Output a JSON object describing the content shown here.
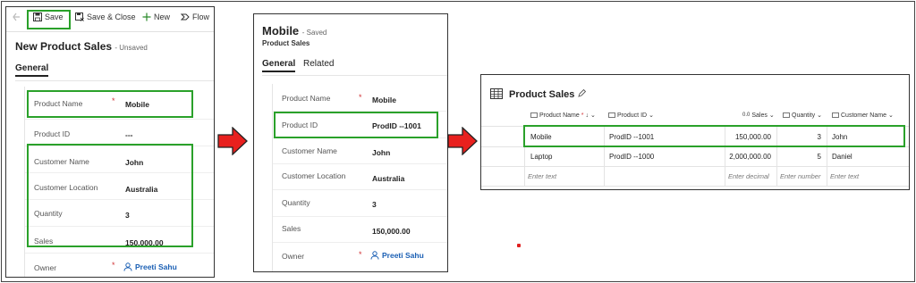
{
  "panel1": {
    "toolbar": {
      "save_label": "Save",
      "save_close_label": "Save & Close",
      "new_label": "New",
      "flow_label": "Flow"
    },
    "title": "New Product Sales",
    "status": "- Unsaved",
    "tab_general": "General",
    "fields": [
      {
        "label": "Product Name",
        "required": "*",
        "value": "Mobile"
      },
      {
        "label": "Product ID",
        "value": "---"
      },
      {
        "label": "Customer Name",
        "value": "John"
      },
      {
        "label": "Customer Location",
        "value": "Australia"
      },
      {
        "label": "Quantity",
        "value": "3"
      },
      {
        "label": "Sales",
        "value": "150,000.00"
      },
      {
        "label": "Owner",
        "required": "*",
        "value": "Preeti Sahu"
      }
    ]
  },
  "panel2": {
    "title": "Mobile",
    "status": "- Saved",
    "entity": "Product Sales",
    "tab_general": "General",
    "tab_related": "Related",
    "fields": [
      {
        "label": "Product Name",
        "required": "*",
        "value": "Mobile"
      },
      {
        "label": "Product ID",
        "value": "ProdID --1001"
      },
      {
        "label": "Customer Name",
        "value": "John"
      },
      {
        "label": "Customer Location",
        "value": "Australia"
      },
      {
        "label": "Quantity",
        "value": "3"
      },
      {
        "label": "Sales",
        "value": "150,000.00"
      },
      {
        "label": "Owner",
        "required": "*",
        "value": "Preeti Sahu"
      }
    ]
  },
  "panel3": {
    "title": "Product Sales",
    "columns": [
      "Product Name",
      "Product ID",
      "Sales",
      "Quantity",
      "Customer Name"
    ],
    "rows": [
      [
        "Mobile",
        "ProdID --1001",
        "150,000.00",
        "3",
        "John"
      ],
      [
        "Laptop",
        "ProdID --1000",
        "2,000,000.00",
        "5",
        "Daniel"
      ]
    ],
    "placeholders": [
      "Enter text",
      "Enter decimal",
      "Enter number",
      "Enter text"
    ]
  },
  "colors": {
    "highlight": "#2aa12a",
    "arrow": "#e8201e",
    "link": "#1a5fb4"
  }
}
